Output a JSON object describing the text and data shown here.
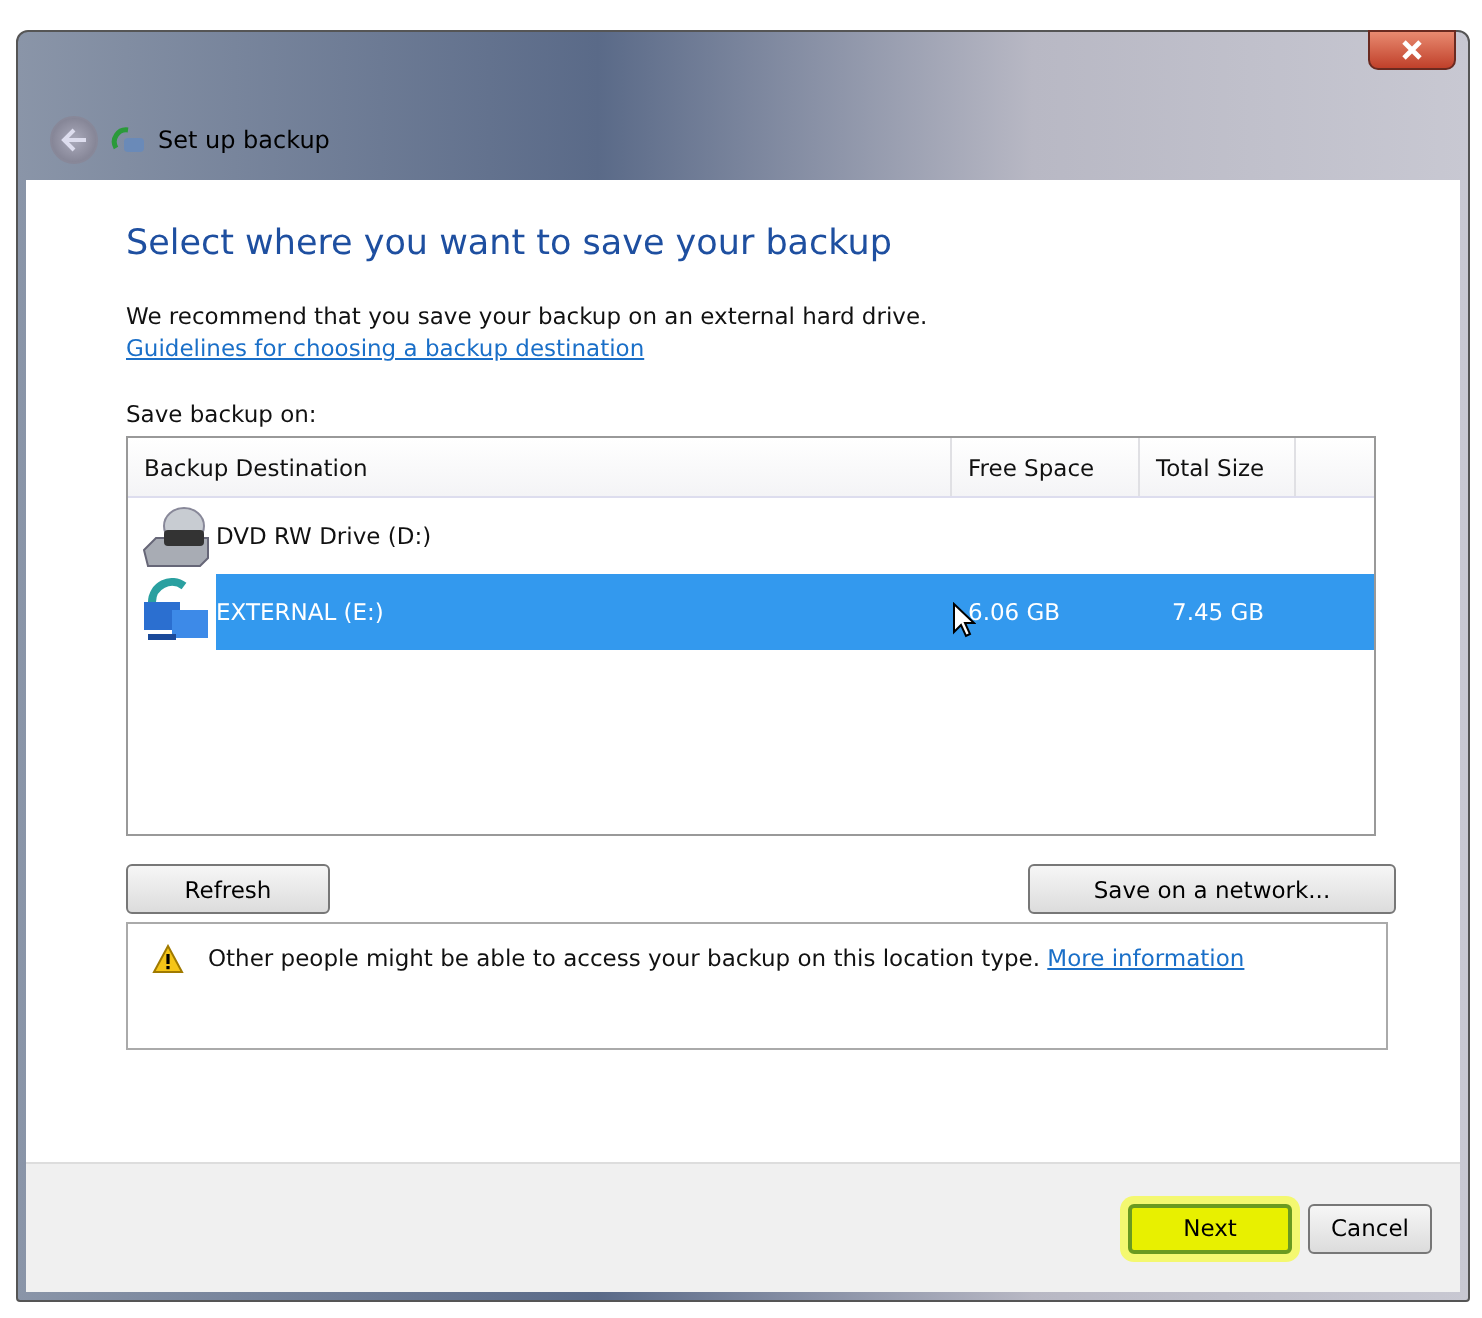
{
  "window": {
    "title": "Set up backup"
  },
  "heading": "Select where you want to save your backup",
  "intro": {
    "text": "We recommend that you save your backup on an external hard drive.",
    "link": "Guidelines for choosing a backup destination"
  },
  "list_label": "Save backup on:",
  "table": {
    "columns": [
      "Backup Destination",
      "Free Space",
      "Total Size"
    ],
    "rows": [
      {
        "kind": "dvd",
        "name": "DVD RW Drive (D:)",
        "free": "",
        "total": "",
        "selected": false
      },
      {
        "kind": "external",
        "name": "EXTERNAL (E:)",
        "free": "6.06 GB",
        "total": "7.45 GB",
        "selected": true
      }
    ]
  },
  "list_buttons": [
    "Refresh",
    "Save on a network..."
  ],
  "warning": {
    "text": "Other people might be able to access your backup on this location type.",
    "link": "More information"
  },
  "footer_buttons": [
    {
      "label": "Next",
      "highlighted": true
    },
    {
      "label": "Cancel",
      "highlighted": false
    }
  ]
}
